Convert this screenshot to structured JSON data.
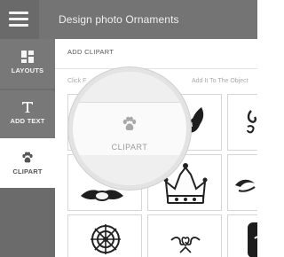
{
  "header": {
    "title": "Design photo Ornaments",
    "menu_icon": "hamburger-menu-icon"
  },
  "sidebar": {
    "items": [
      {
        "label": "LAYOUTS",
        "icon": "layouts-grid-icon"
      },
      {
        "label": "ADD TEXT",
        "icon": "text-t-icon"
      },
      {
        "label": "CLIPART",
        "icon": "paw-icon",
        "active": true
      }
    ]
  },
  "panel": {
    "heading": "ADD CLIPART",
    "hint_left": "Click F",
    "hint_right": "Add It To The Object",
    "magnifier": {
      "label": "CLIPART",
      "icon": "paw-icon"
    }
  },
  "clipart_tiles": [
    {
      "icon": "wings-clipart-icon"
    },
    {
      "icon": "ornament-clipart-icon"
    },
    {
      "icon": "lotus-clipart-icon"
    },
    {
      "icon": "crown-clipart-icon"
    },
    {
      "icon": "flourish-clipart-icon"
    },
    {
      "icon": "mandala-clipart-icon"
    },
    {
      "icon": "heart-swirl-clipart-icon"
    },
    {
      "icon": "dark-shape-clipart-icon"
    }
  ],
  "colors": {
    "topbar": "#747474",
    "sidebar": "#6e6e6e",
    "active_item": "#ffffff",
    "panel": "#ffffff"
  }
}
